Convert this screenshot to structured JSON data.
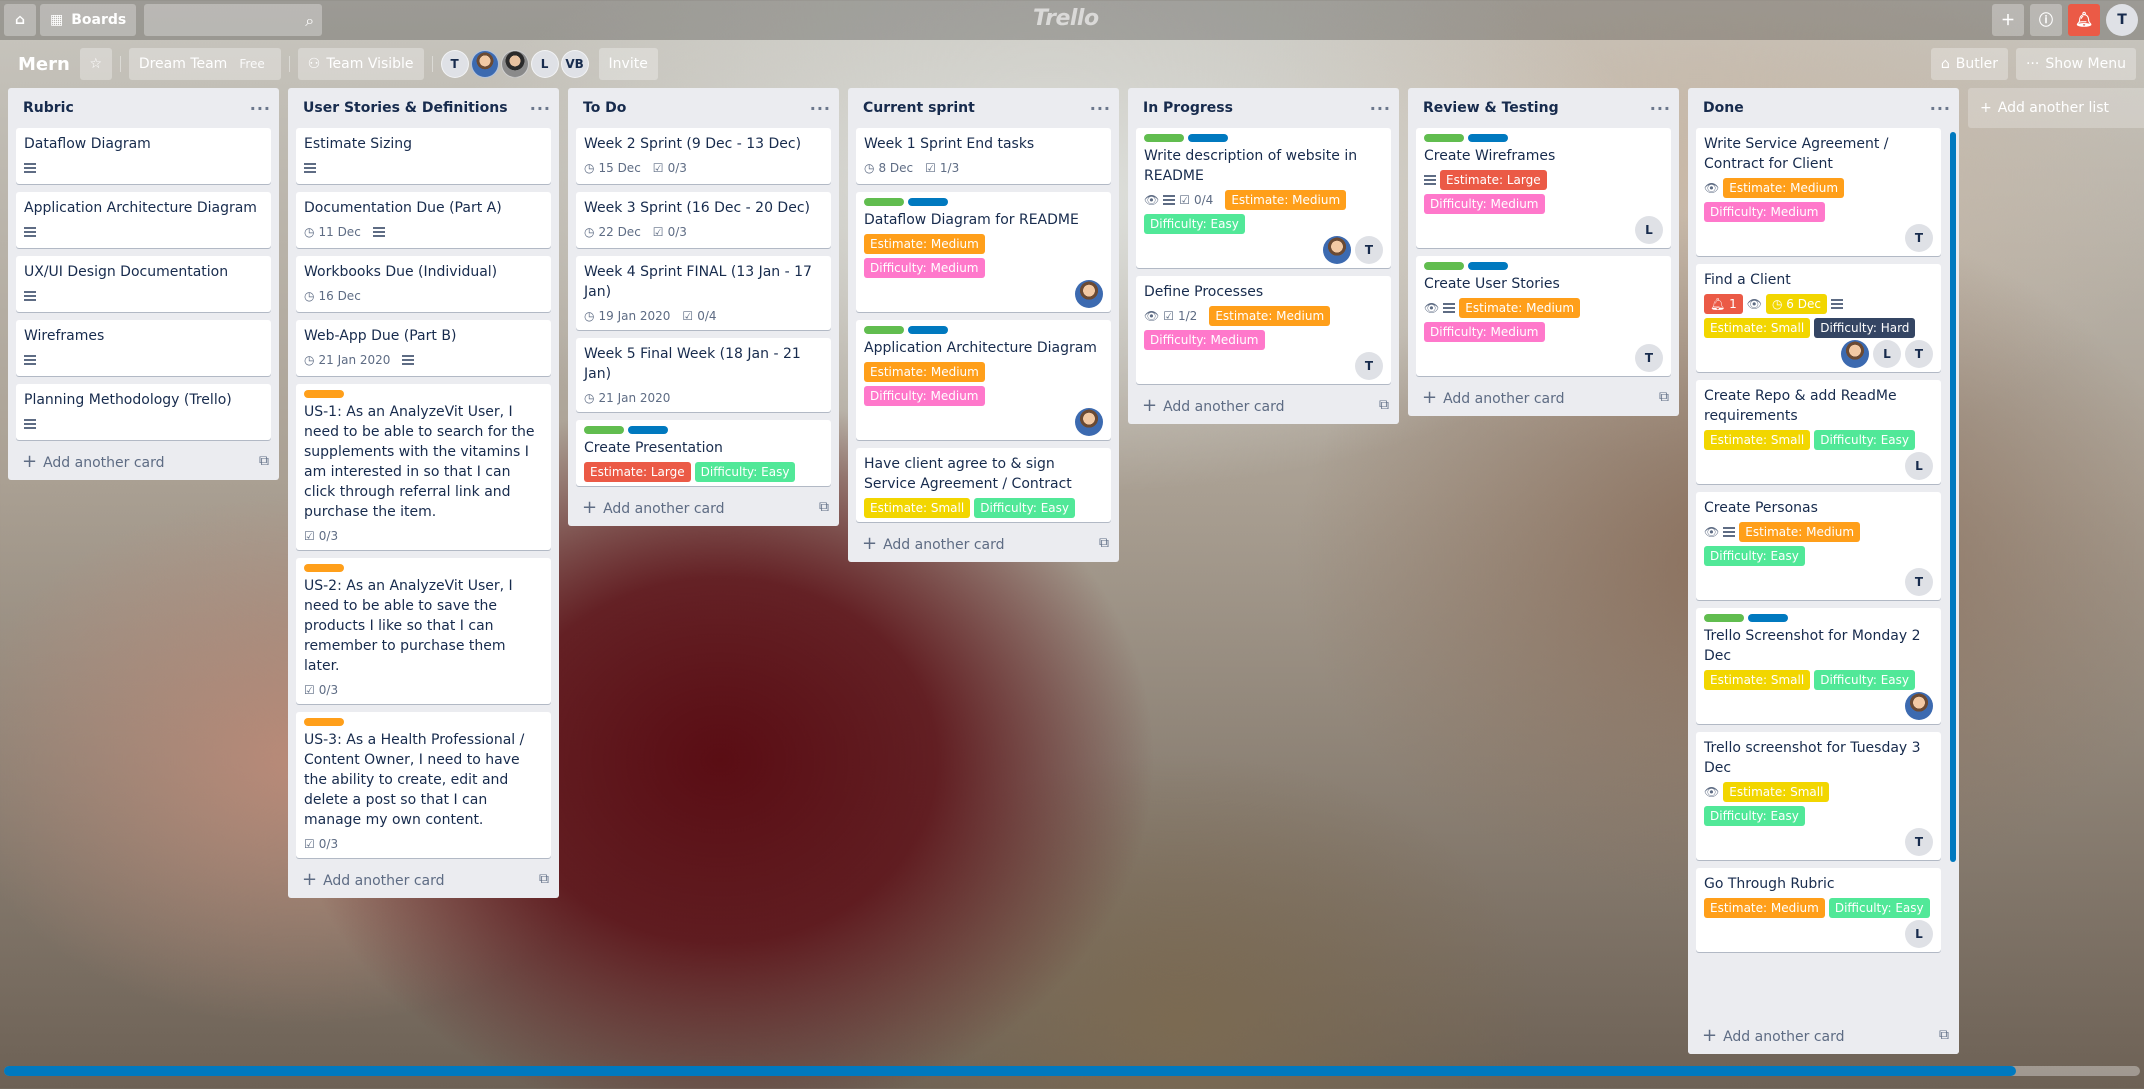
{
  "topbar": {
    "boards_label": "Boards",
    "search_placeholder": "",
    "logo": "Trello",
    "user_initial": "T"
  },
  "board": {
    "name": "Mern",
    "team": "Dream Team",
    "team_plan": "Free",
    "visibility": "Team Visible",
    "members": [
      "T",
      "",
      "",
      "L",
      "VB"
    ],
    "invite": "Invite",
    "butler": "Butler",
    "show_menu": "Show Menu"
  },
  "add_another_card": "Add another card",
  "add_another_list": "Add another list",
  "lists": [
    {
      "title": "Rubric",
      "cards": [
        {
          "title": "Dataflow Diagram"
        },
        {
          "title": "Application Architecture Diagram"
        },
        {
          "title": "UX/UI Design Documentation"
        },
        {
          "title": "Wireframes"
        },
        {
          "title": "Planning Methodology (Trello)"
        }
      ]
    },
    {
      "title": "User Stories & Definitions",
      "cards": [
        {
          "title": "Estimate Sizing"
        },
        {
          "title": "Documentation Due (Part A)",
          "due": "11 Dec"
        },
        {
          "title": "Workbooks Due (Individual)",
          "due": "16 Dec"
        },
        {
          "title": "Web-App Due (Part B)",
          "due": "21 Jan 2020"
        },
        {
          "title": "US-1: As an AnalyzeVit User, I need to be able to search for the supplements with the vitamins I am interested in so that I can click through referral link and purchase the item.",
          "checklist": "0/3"
        },
        {
          "title": "US-2: As an AnalyzeVit User, I need to be able to save the products I like so that I can remember to purchase them later.",
          "checklist": "0/3"
        },
        {
          "title": "US-3: As a Health Professional / Content Owner, I need to have the ability to create, edit and delete a post so that I can manage my own content.",
          "checklist": "0/3"
        }
      ]
    },
    {
      "title": "To Do",
      "cards": [
        {
          "title": "Week 2 Sprint (9 Dec - 13 Dec)",
          "due": "15 Dec",
          "checklist": "0/3"
        },
        {
          "title": "Week 3 Sprint (16 Dec - 20 Dec)",
          "due": "22 Dec",
          "checklist": "0/3"
        },
        {
          "title": "Week 4 Sprint FINAL (13 Jan - 17 Jan)",
          "due": "19 Jan 2020",
          "checklist": "0/4"
        },
        {
          "title": "Week 5 Final Week (18 Jan - 21 Jan)",
          "due": "21 Jan 2020"
        },
        {
          "title": "Create Presentation",
          "estimate": "Estimate: Large",
          "difficulty": "Difficulty: Easy"
        }
      ]
    },
    {
      "title": "Current sprint",
      "cards": [
        {
          "title": "Week 1 Sprint End tasks",
          "due": "8 Dec",
          "checklist": "1/3"
        },
        {
          "title": "Dataflow Diagram for README",
          "estimate": "Estimate: Medium",
          "difficulty": "Difficulty: Medium"
        },
        {
          "title": "Application Architecture Diagram",
          "estimate": "Estimate: Medium",
          "difficulty": "Difficulty: Medium"
        },
        {
          "title": "Have client agree to & sign Service Agreement / Contract",
          "estimate": "Estimate: Small",
          "difficulty": "Difficulty: Easy"
        }
      ]
    },
    {
      "title": "In Progress",
      "cards": [
        {
          "title": "Write description of website in README",
          "checklist": "0/4",
          "estimate": "Estimate: Medium",
          "difficulty": "Difficulty: Easy",
          "member": "T"
        },
        {
          "title": "Define Processes",
          "checklist": "1/2",
          "estimate": "Estimate: Medium",
          "difficulty": "Difficulty: Medium",
          "member": "T"
        }
      ]
    },
    {
      "title": "Review & Testing",
      "cards": [
        {
          "title": "Create Wireframes",
          "estimate": "Estimate: Large",
          "difficulty": "Difficulty: Medium",
          "member": "L"
        },
        {
          "title": "Create User Stories",
          "estimate": "Estimate: Medium",
          "difficulty": "Difficulty: Medium",
          "member": "T"
        }
      ]
    },
    {
      "title": "Done",
      "cards": [
        {
          "title": "Write Service Agreement / Contract for Client",
          "estimate": "Estimate: Medium",
          "difficulty": "Difficulty: Medium",
          "member": "T"
        },
        {
          "title": "Find a Client",
          "notifications": "1",
          "due": "6 Dec",
          "estimate": "Estimate: Small",
          "difficulty": "Difficulty: Hard",
          "members": [
            "L",
            "T"
          ]
        },
        {
          "title": "Create Repo & add ReadMe requirements",
          "estimate": "Estimate: Small",
          "difficulty": "Difficulty: Easy",
          "member": "L"
        },
        {
          "title": "Create Personas",
          "estimate": "Estimate: Medium",
          "difficulty": "Difficulty: Easy",
          "member": "T"
        },
        {
          "title": "Trello Screenshot for Monday 2 Dec",
          "estimate": "Estimate: Small",
          "difficulty": "Difficulty: Easy"
        },
        {
          "title": "Trello screenshot for Tuesday 3 Dec",
          "estimate": "Estimate: Small",
          "difficulty": "Difficulty: Easy",
          "member": "T"
        },
        {
          "title": "Go Through Rubric",
          "estimate": "Estimate: Medium",
          "difficulty": "Difficulty: Easy",
          "member": "L"
        }
      ]
    }
  ]
}
